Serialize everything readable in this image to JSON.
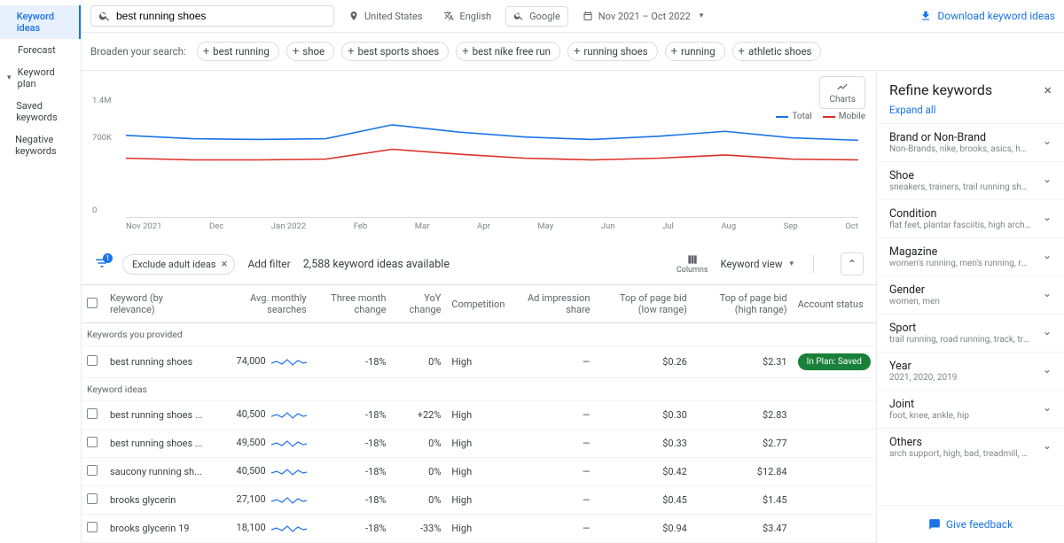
{
  "nav": {
    "keyword_ideas": "Keyword ideas",
    "forecast": "Forecast",
    "keyword_plan": "Keyword plan",
    "saved_keywords": "Saved keywords",
    "negative_keywords": "Negative keywords"
  },
  "topbar": {
    "search_value": "best running shoes",
    "location": "United States",
    "language": "English",
    "network": "Google",
    "date_range": "Nov 2021 – Oct 2022",
    "download": "Download keyword ideas"
  },
  "chips": {
    "label": "Broaden your search:",
    "items": [
      "best running",
      "shoe",
      "best sports shoes",
      "best nike free run",
      "running shoes",
      "running",
      "athletic shoes"
    ]
  },
  "chart_btn": "Charts",
  "legend": {
    "total": "Total",
    "mobile": "Mobile"
  },
  "chart_data": {
    "type": "line",
    "title": "",
    "ylabel": "",
    "ylim": [
      0,
      1400000
    ],
    "yticks": [
      "0",
      "700K",
      "1.4M"
    ],
    "categories": [
      "Nov 2021",
      "Dec",
      "Jan 2022",
      "Feb",
      "Mar",
      "Apr",
      "May",
      "Jun",
      "Jul",
      "Aug",
      "Sep",
      "Oct"
    ],
    "series": [
      {
        "name": "Total",
        "color": "#1a73e8",
        "values": [
          1000000,
          960000,
          950000,
          960000,
          1130000,
          1040000,
          980000,
          950000,
          990000,
          1050000,
          970000,
          940000
        ]
      },
      {
        "name": "Mobile",
        "color": "#d93025",
        "values": [
          720000,
          700000,
          700000,
          710000,
          830000,
          770000,
          720000,
          700000,
          720000,
          760000,
          710000,
          700000
        ]
      }
    ]
  },
  "filters": {
    "exclude": "Exclude adult ideas",
    "add_filter": "Add filter",
    "ideas_count": "2,588 keyword ideas available",
    "columns": "Columns",
    "view": "Keyword view"
  },
  "table": {
    "headers": {
      "keyword": "Keyword (by relevance)",
      "searches": "Avg. monthly searches",
      "three_month": "Three month change",
      "yoy": "YoY change",
      "competition": "Competition",
      "ad_impr": "Ad impression share",
      "low_bid": "Top of page bid (low range)",
      "high_bid": "Top of page bid (high range)",
      "account": "Account status"
    },
    "section_provided": "Keywords you provided",
    "section_ideas": "Keyword ideas",
    "status_saved": "In Plan: Saved",
    "rows_provided": [
      {
        "kw": "best running shoes",
        "searches": "74,000",
        "three": "-18%",
        "yoy": "0%",
        "comp": "High",
        "ad": "—",
        "low": "$0.26",
        "high": "$2.31",
        "status": "saved"
      }
    ],
    "rows_ideas": [
      {
        "kw": "best running shoes ...",
        "searches": "40,500",
        "three": "-18%",
        "yoy": "+22%",
        "comp": "High",
        "ad": "—",
        "low": "$0.30",
        "high": "$2.83"
      },
      {
        "kw": "best running shoes ...",
        "searches": "49,500",
        "three": "-18%",
        "yoy": "0%",
        "comp": "High",
        "ad": "—",
        "low": "$0.33",
        "high": "$2.77"
      },
      {
        "kw": "saucony running sh...",
        "searches": "40,500",
        "three": "-18%",
        "yoy": "0%",
        "comp": "High",
        "ad": "—",
        "low": "$0.42",
        "high": "$12.84"
      },
      {
        "kw": "brooks glycerin",
        "searches": "27,100",
        "three": "-18%",
        "yoy": "0%",
        "comp": "High",
        "ad": "—",
        "low": "$0.45",
        "high": "$1.45"
      },
      {
        "kw": "brooks glycerin 19",
        "searches": "18,100",
        "three": "-18%",
        "yoy": "-33%",
        "comp": "High",
        "ad": "—",
        "low": "$0.94",
        "high": "$3.47"
      }
    ]
  },
  "refine": {
    "title": "Refine keywords",
    "expand": "Expand all",
    "feedback": "Give feedback",
    "facets": [
      {
        "t": "Brand or Non-Brand",
        "s": "Non-Brands, nike, brooks, asics, hoka"
      },
      {
        "t": "Shoe",
        "s": "sneakers, trainers, trail running shoes, stabilit..."
      },
      {
        "t": "Condition",
        "s": "flat feet, plantar fasciitis, high arches, foot pa..."
      },
      {
        "t": "Magazine",
        "s": "women's running, men's running, runner's wor..."
      },
      {
        "t": "Gender",
        "s": "women, men"
      },
      {
        "t": "Sport",
        "s": "trail running, road running, track, track runnin..."
      },
      {
        "t": "Year",
        "s": "2021, 2020, 2019"
      },
      {
        "t": "Joint",
        "s": "foot, knee, ankle, hip"
      },
      {
        "t": "Others",
        "s": "arch support, high, bad, treadmill, shock abso..."
      }
    ]
  }
}
